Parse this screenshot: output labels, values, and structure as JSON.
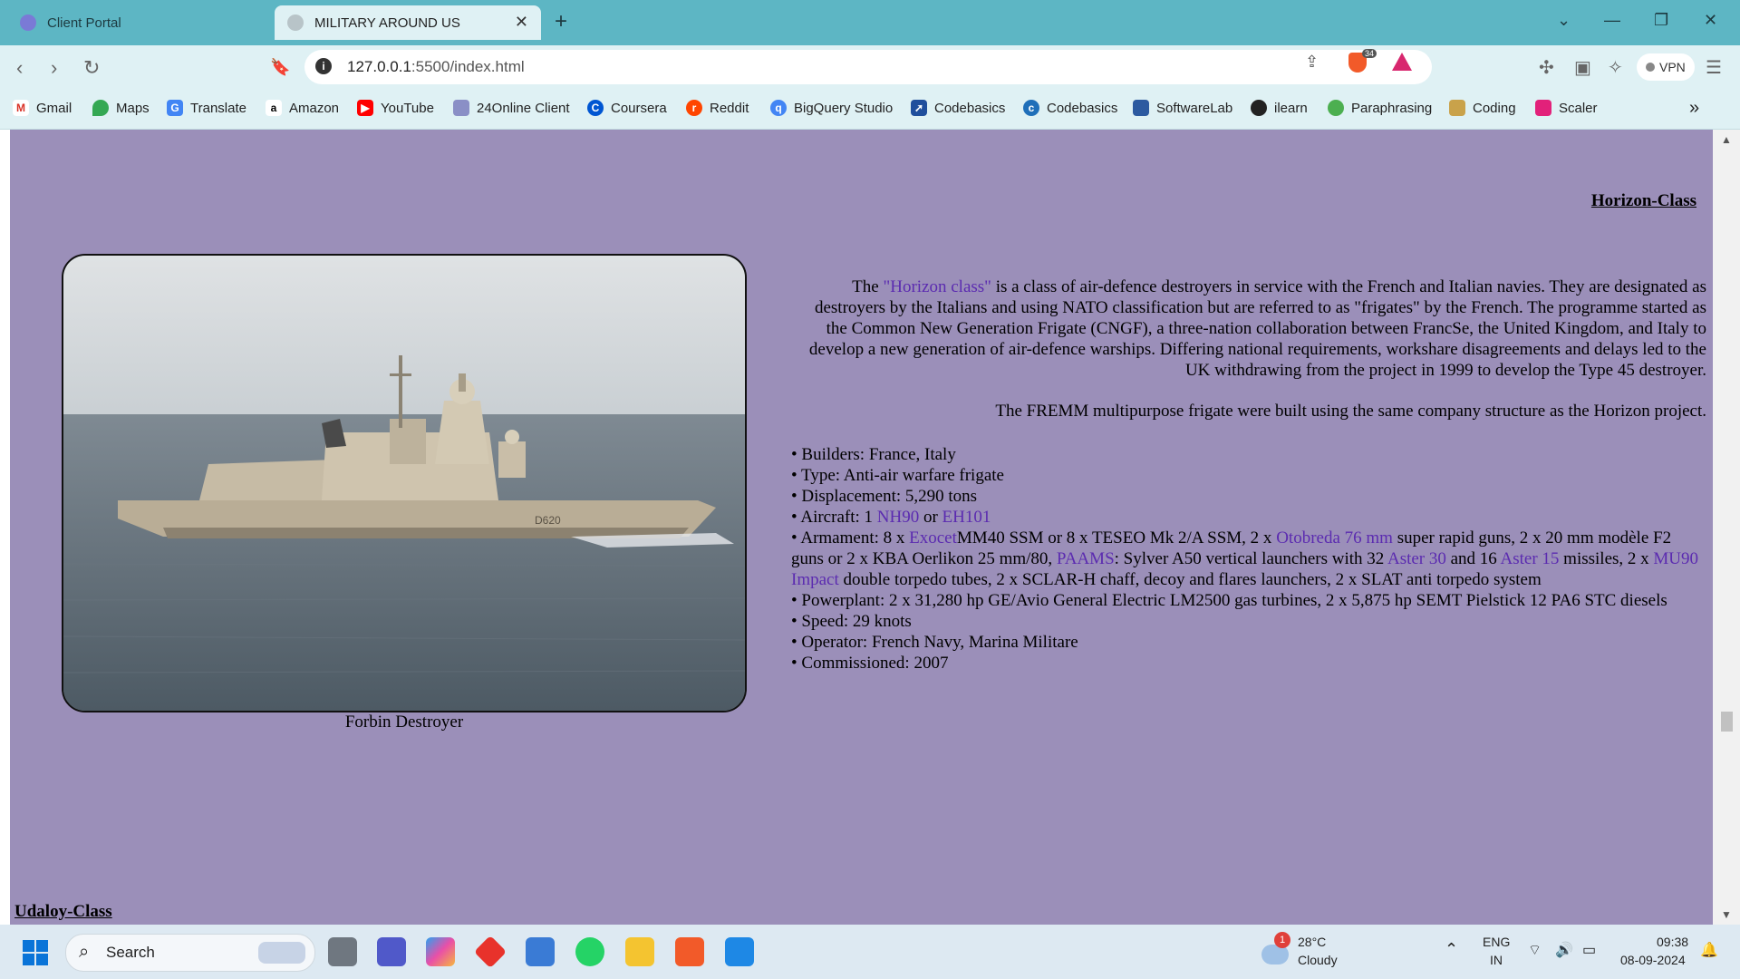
{
  "browser": {
    "tabs": [
      {
        "title": "Client Portal",
        "active": false
      },
      {
        "title": "MILITARY AROUND US",
        "active": true
      }
    ],
    "url_host": "127.0.0.1",
    "url_path": ":5500/index.html",
    "brave_badge": "34",
    "vpn_label": "VPN",
    "bookmarks": [
      "Gmail",
      "Maps",
      "Translate",
      "Amazon",
      "YouTube",
      "24Online Client",
      "Coursera",
      "Reddit",
      "BigQuery Studio",
      "Codebasics",
      "Codebasics",
      "SoftwareLab",
      "ilearn",
      "Paraphrasing",
      "Coding",
      "Scaler"
    ]
  },
  "page": {
    "heading": "Horizon-Class",
    "caption": "Forbin Destroyer",
    "para1_pre": "The ",
    "para1_link": "\"Horizon class\"",
    "para1_post": " is a class of air-defence destroyers in service with the French and Italian navies. They are designated as destroyers by the Italians and using NATO classification but are referred to as \"frigates\" by the French. The programme started as the Common New Generation Frigate (CNGF), a three-nation collaboration between FrancSe, the United Kingdom, and Italy to develop a new generation of air-defence warships. Differing national requirements, workshare disagreements and delays led to the UK withdrawing from the project in 1999 to develop the Type 45 destroyer.",
    "para2": "The FREMM multipurpose frigate were built using the same company structure as the Horizon project.",
    "specs": {
      "builders": "• Builders: France, Italy",
      "type": "• Type: Anti-air warfare frigate",
      "displacement": "• Displacement: 5,290 tons",
      "aircraft_pre": "• Aircraft: 1 ",
      "aircraft_link1": "NH90",
      "aircraft_mid": " or ",
      "aircraft_link2": "EH101",
      "arm_1": "• Armament: 8 x ",
      "arm_link_exocet": "Exocet",
      "arm_2": "MM40 SSM or 8 x TESEO Mk 2/A SSM, 2 x ",
      "arm_link_otobreda": "Otobreda 76 mm",
      "arm_3": " super rapid guns, 2 x 20 mm modèle F2 guns or 2 x KBA Oerlikon 25 mm/80, ",
      "arm_link_paams": "PAAMS",
      "arm_4": ": Sylver A50 vertical launchers with 32 ",
      "arm_link_aster30": "Aster 30",
      "arm_5": " and 16 ",
      "arm_link_aster15": "Aster 15",
      "arm_6": " missiles, 2 x ",
      "arm_link_mu90": "MU90 Impact",
      "arm_7": " double torpedo tubes, 2 x SCLAR-H chaff, decoy and flares launchers, 2 x SLAT anti torpedo system",
      "powerplant": "• Powerplant: 2 x 31,280 hp GE/Avio General Electric LM2500 gas turbines, 2 x 5,875 hp SEMT Pielstick 12 PA6 STC diesels",
      "speed": "• Speed: 29 knots",
      "operator": "• Operator: French Navy, Marina Militare",
      "commissioned": "• Commissioned: 2007"
    },
    "hull_number": "D620",
    "next_heading": "Udaloy-Class"
  },
  "taskbar": {
    "search_label": "Search",
    "weather_badge": "1",
    "weather_temp": "28°C",
    "weather_desc": "Cloudy",
    "lang": "ENG",
    "region": "IN",
    "time": "09:38",
    "date": "08-09-2024"
  }
}
